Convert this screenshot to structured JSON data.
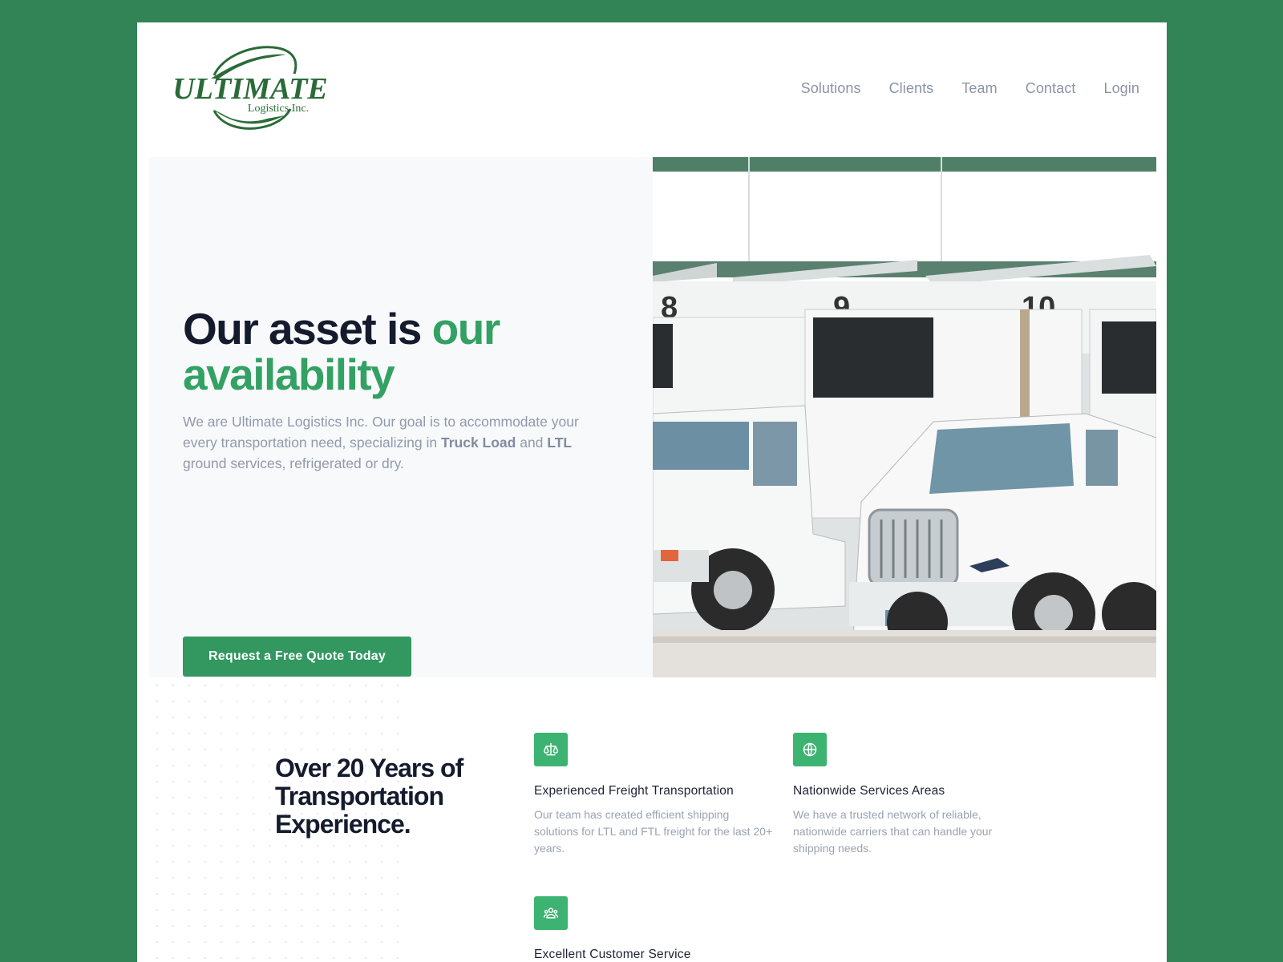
{
  "brand": {
    "logo_text": "ULTIMATE",
    "logo_subtext": "Logistics Inc.",
    "primary_color": "#329860",
    "accent_green": "#33a163",
    "frame_color": "#328355"
  },
  "nav": {
    "items": [
      "Solutions",
      "Clients",
      "Team",
      "Contact",
      "Login"
    ]
  },
  "hero": {
    "headline_part1": "Our asset is ",
    "headline_part2": "our availability",
    "intro_part1": "We are Ultimate Logistics Inc. Our goal is to accommodate your every transportation need, specializing in ",
    "intro_bold1": "Truck Load",
    "intro_part2": " and ",
    "intro_bold2": "LTL",
    "intro_part3": " ground services, refrigerated or dry.",
    "cta_label": "Request a Free Quote Today",
    "image": "truck-photo",
    "dock_numbers": [
      "8",
      "9",
      "10"
    ]
  },
  "features": {
    "title": "Over 20 Years of Transportation Experience.",
    "items": [
      {
        "icon": "scale-icon",
        "title": "Experienced Freight Transportation",
        "description": "Our team has created efficient shipping solutions for LTL and FTL freight for the last 20+ years."
      },
      {
        "icon": "globe-icon",
        "title": "Nationwide Services Areas",
        "description": "We have a trusted network of reliable, nationwide carriers that can handle your shipping needs."
      },
      {
        "icon": "users-icon",
        "title": "Excellent Customer Service",
        "description": ""
      }
    ]
  }
}
